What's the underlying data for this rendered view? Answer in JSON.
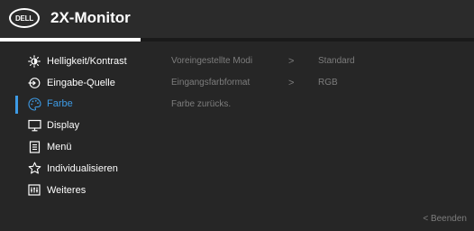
{
  "header": {
    "logo_text": "DELL",
    "title": "2X-Monitor",
    "progress": 0.297
  },
  "sidebar": {
    "items": [
      {
        "label": "Helligkeit/Kontrast",
        "icon": "brightness-icon",
        "active": false
      },
      {
        "label": "Eingabe-Quelle",
        "icon": "input-source-icon",
        "active": false
      },
      {
        "label": "Farbe",
        "icon": "color-palette-icon",
        "active": true
      },
      {
        "label": "Display",
        "icon": "display-monitor-icon",
        "active": false
      },
      {
        "label": "Menü",
        "icon": "menu-document-icon",
        "active": false
      },
      {
        "label": "Individualisieren",
        "icon": "star-icon",
        "active": false
      },
      {
        "label": "Weiteres",
        "icon": "other-settings-icon",
        "active": false
      }
    ]
  },
  "submenu": {
    "rows": [
      {
        "label": "Voreingestellte Modi",
        "arrow": ">",
        "value": "Standard"
      },
      {
        "label": "Eingangsfarbformat",
        "arrow": ">",
        "value": "RGB"
      },
      {
        "label": "Farbe zurücks.",
        "arrow": "",
        "value": ""
      }
    ]
  },
  "footer": {
    "exit_label": "< Beenden"
  },
  "colors": {
    "accent": "#3d9be6",
    "background": "#262626",
    "header": "#2b2b2b",
    "dim_text": "#7d7d7d"
  }
}
